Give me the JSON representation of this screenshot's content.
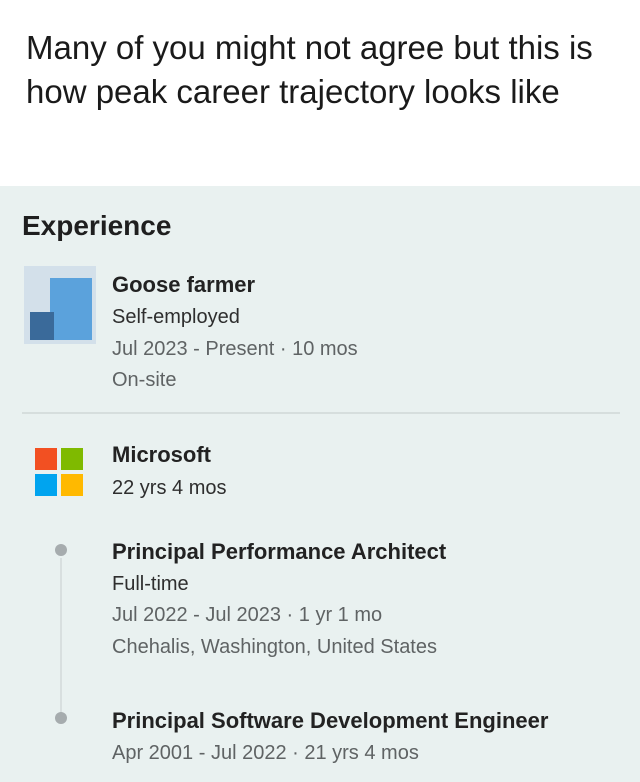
{
  "caption": "Many of you might not agree but this is how peak career trajectory looks like",
  "experience": {
    "section_title": "Experience",
    "goose": {
      "title": "Goose farmer",
      "employer": "Self-employed",
      "dates": "Jul 2023 - Present · 10 mos",
      "location": "On-site",
      "logo_icon": "goose-farm-logo-icon"
    },
    "microsoft": {
      "company": "Microsoft",
      "tenure": "22 yrs 4 mos",
      "logo_icon": "microsoft-logo-icon",
      "logo_colors": [
        "#f25022",
        "#7fba00",
        "#00a4ef",
        "#ffb900"
      ],
      "roles": [
        {
          "title": "Principal Performance Architect",
          "type": "Full-time",
          "dates": "Jul 2022 - Jul 2023 · 1 yr 1 mo",
          "location": "Chehalis, Washington, United States"
        },
        {
          "title": "Principal Software Development Engineer",
          "dates": "Apr 2001 - Jul 2022 · 21 yrs 4 mos"
        }
      ]
    }
  }
}
